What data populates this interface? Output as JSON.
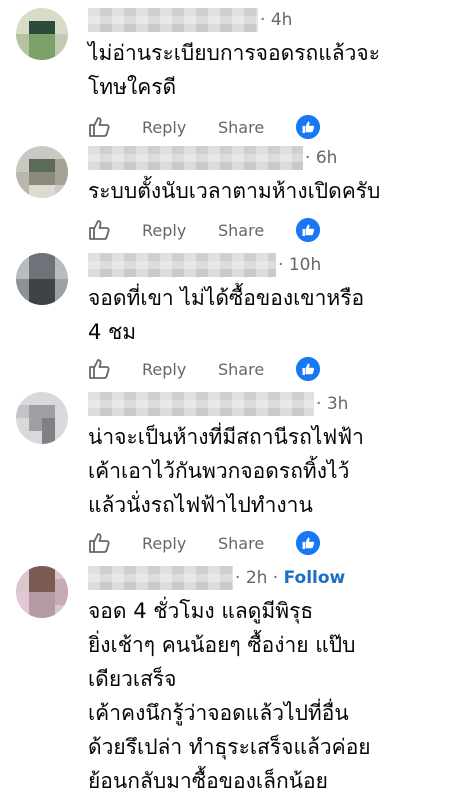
{
  "comments": [
    {
      "time": "4h",
      "follow": "",
      "lines": [
        "ไม่อ่านระเบียบการจอดรถแล้วจะ",
        "โทษใครดี"
      ],
      "reply_label": "Reply",
      "share_label": "Share"
    },
    {
      "time": "6h",
      "follow": "",
      "lines": [
        "ระบบตั้งนับเวลาตามห้างเปิดครับ"
      ],
      "reply_label": "Reply",
      "share_label": "Share"
    },
    {
      "time": "10h",
      "follow": "",
      "lines": [
        "จอดที่เขา ไม่ได้ซื้อของเขาหรือ",
        "4 ชม"
      ],
      "reply_label": "Reply",
      "share_label": "Share"
    },
    {
      "time": "3h",
      "follow": "",
      "lines": [
        "น่าจะเป็นห้างที่มีสถานีรถไฟฟ้า",
        "เค้าเอาไว้กันพวกจอดรถทิ้งไว้",
        "แล้วนั่งรถไฟฟ้าไปทำงาน"
      ],
      "reply_label": "Reply",
      "share_label": "Share"
    },
    {
      "time": "2h",
      "follow": "Follow",
      "lines": [
        "จอด 4 ชั่วโมง แลดูมีพิรุธ",
        "ยิ่งเช้าๆ คนน้อยๆ ซื้อง่าย แป๊บ",
        "เดียวเสร็จ",
        "เค้าคงนึกรู้ว่าจอดแล้วไปที่อื่น",
        "ด้วยรึเปล่า ทำธุระเสร็จแล้วค่อย",
        "ย้อนกลับมาซื้อของเล็กน้อย"
      ],
      "reply_label": "",
      "share_label": ""
    }
  ],
  "colors": {
    "meta_gray": "#65676b",
    "link_blue": "#1a6fc4",
    "reaction_blue": "#1877f2",
    "text": "#050505"
  },
  "icons": {
    "like": "thumbs-up-outline-icon",
    "reaction": "thumbs-up-filled-icon"
  }
}
